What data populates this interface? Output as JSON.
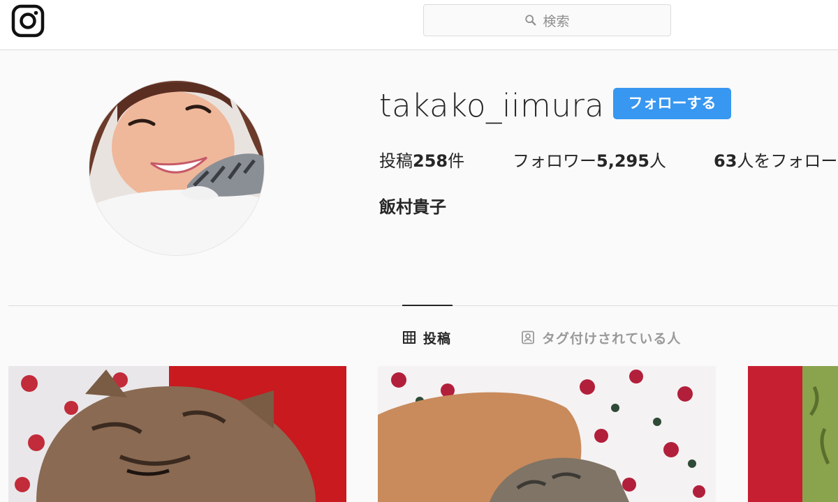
{
  "header": {
    "logo_icon": "instagram-camera-icon",
    "search": {
      "icon": "search-icon",
      "placeholder": "検索"
    }
  },
  "profile": {
    "username": "takako_iimura",
    "follow_label": "フォローする",
    "stats": {
      "posts_prefix": "投稿",
      "posts_count": "258",
      "posts_suffix": "件",
      "followers_prefix": "フォロワー",
      "followers_count": "5,295",
      "followers_suffix": "人",
      "following_count": "63",
      "following_suffix": "人をフォロー"
    },
    "full_name": "飯村貴子"
  },
  "tabs": [
    {
      "label": "投稿",
      "icon": "grid-icon",
      "active": true
    },
    {
      "label": "タグ付けされている人",
      "icon": "tagged-person-icon",
      "active": false
    }
  ],
  "colors": {
    "accent": "#3897f0",
    "background": "#fafafa",
    "text": "#262626",
    "muted": "#8e8e8e"
  }
}
